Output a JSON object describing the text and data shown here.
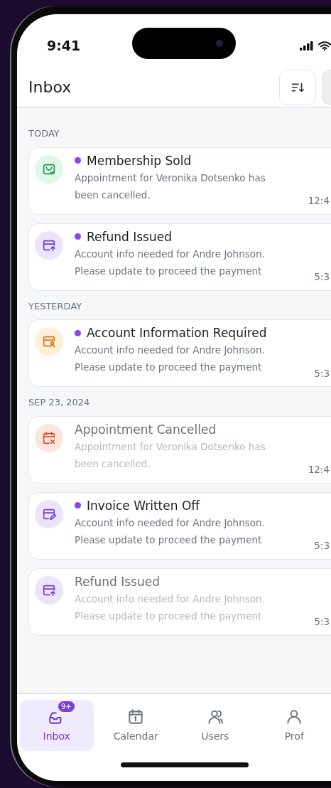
{
  "status_bar": {
    "time": "9:41"
  },
  "header": {
    "title": "Inbox"
  },
  "sections": [
    {
      "label": "TODAY",
      "notifications": [
        {
          "kind": "membership",
          "unread": true,
          "title": "Membership Sold",
          "body": "Appointment for Veronika Dotsenko has been cancelled.",
          "time": "12:4"
        },
        {
          "kind": "refund",
          "unread": true,
          "title": "Refund Issued",
          "body": "Account info needed for Andre Johnson. Please update to proceed the payment",
          "time": "5:3"
        }
      ]
    },
    {
      "label": "YESTERDAY",
      "notifications": [
        {
          "kind": "account",
          "unread": true,
          "title": "Account Information Required",
          "body": "Account info needed for Andre Johnson. Please update to proceed the payment",
          "time": "5:3"
        }
      ]
    },
    {
      "label": "SEP 23, 2024",
      "notifications": [
        {
          "kind": "cancelled",
          "unread": false,
          "title": "Appointment Cancelled",
          "body": "Appointment for Veronika Dotsenko has been cancelled.",
          "time": "12:4"
        },
        {
          "kind": "invoice",
          "unread": true,
          "title": "Invoice Written Off",
          "body": "Account info needed for Andre Johnson. Please update to proceed the payment",
          "time": "5:3"
        },
        {
          "kind": "refund",
          "unread": false,
          "title": "Refund Issued",
          "body": "Account info needed for Andre Johnson. Please update to proceed the payment",
          "time": "5:3"
        }
      ]
    }
  ],
  "tab_bar": [
    {
      "kind": "inbox",
      "label": "Inbox",
      "selected": true,
      "badge": "9+"
    },
    {
      "kind": "calendar",
      "label": "Calendar",
      "selected": false
    },
    {
      "kind": "users",
      "label": "Users",
      "selected": false
    },
    {
      "kind": "profile",
      "label": "Prof",
      "selected": false
    }
  ]
}
